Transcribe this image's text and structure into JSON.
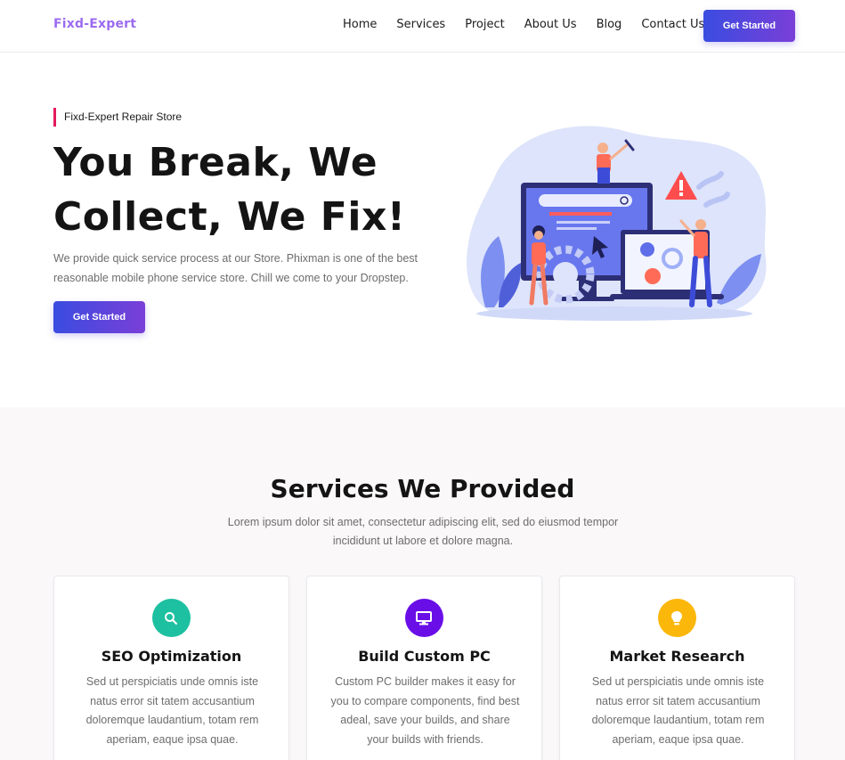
{
  "header": {
    "logo": "Fixd-Expert",
    "nav": [
      "Home",
      "Services",
      "Project",
      "About Us",
      "Blog",
      "Contact Us"
    ],
    "cta_label": "Get Started"
  },
  "hero": {
    "tagline": "Fixd-Expert Repair Store",
    "title_line1": "You Break, We",
    "title_line2": "Collect, We Fix!",
    "description": "We provide quick service process at our Store. Phixman is one of the best reasonable mobile phone service store. Chill we come to your Dropstep.",
    "cta_label": "Get Started"
  },
  "services": {
    "title": "Services We Provided",
    "description": "Lorem ipsum dolor sit amet, consectetur adipiscing elit, sed do eiusmod tempor incididunt ut labore et dolore magna.",
    "cards": [
      {
        "icon": "search-icon",
        "color": "#1dc0a0",
        "title": "SEO Optimization",
        "text": "Sed ut perspiciatis unde omnis iste natus error sit tatem accusantium doloremque laudantium, totam rem aperiam, eaque ipsa quae."
      },
      {
        "icon": "monitor-icon",
        "color": "#6a0ee8",
        "title": "Build Custom PC",
        "text": "Custom PC builder makes it easy for you to compare components, find best adeal, save your builds, and share your builds with friends."
      },
      {
        "icon": "lightbulb-icon",
        "color": "#fbb70a",
        "title": "Market Research",
        "text": "Sed ut perspiciatis unde omnis iste natus error sit tatem accusantium doloremque laudantium, totam rem aperiam, eaque ipsa quae."
      }
    ]
  },
  "colors": {
    "brand": "#9b6cf0",
    "gradient_start": "#3a4ce0",
    "gradient_end": "#7a3fd8",
    "tagline_accent": "#e3195c"
  }
}
